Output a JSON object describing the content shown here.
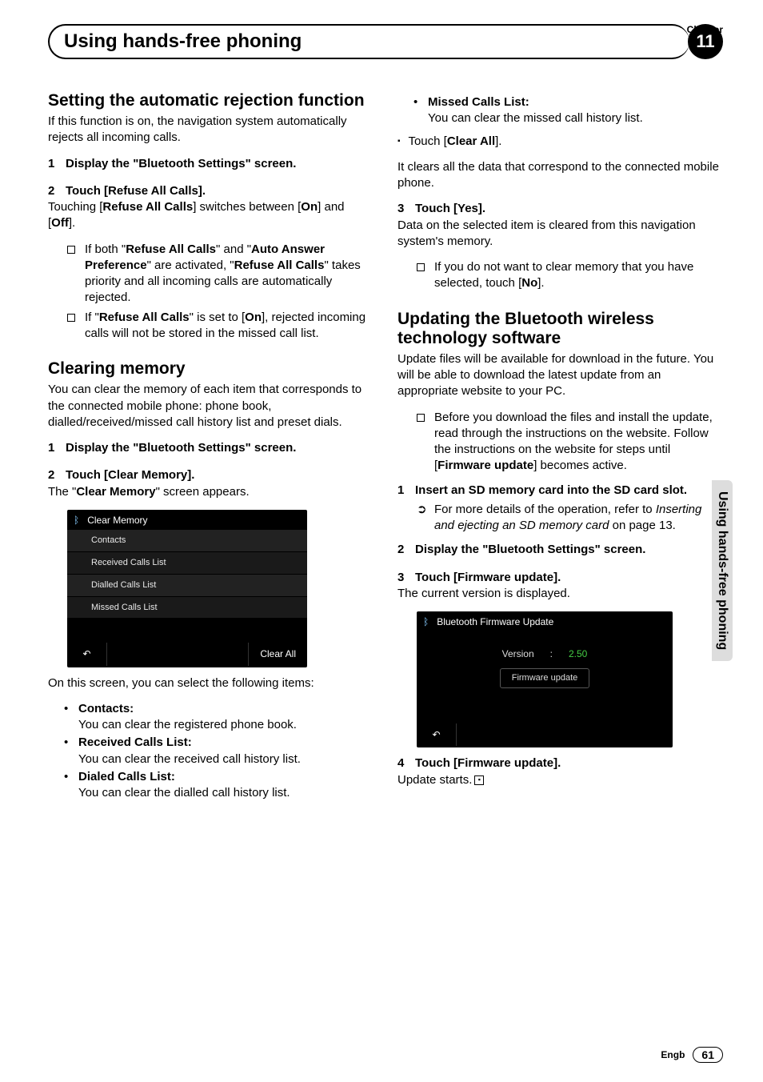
{
  "chapter_label": "Chapter",
  "chapter_number": "11",
  "page_title": "Using hands-free phoning",
  "side_tab": "Using hands-free phoning",
  "footer_lang": "Engb",
  "footer_page": "61",
  "left": {
    "h2a": "Setting the automatic rejection function",
    "p1": "If this function is on, the navigation system automatically rejects all incoming calls.",
    "step1_num": "1",
    "step1": "Display the \"Bluetooth Settings\" screen.",
    "step2_num": "2",
    "step2": "Touch [Refuse All Calls].",
    "p2a": "Touching [",
    "p2b": "Refuse All Calls",
    "p2c": "] switches between [",
    "p2d": "On",
    "p2e": "] and [",
    "p2f": "Off",
    "p2g": "].",
    "note1a": "If both \"",
    "note1b": "Refuse All Calls",
    "note1c": "\" and \"",
    "note1d": "Auto Answer Preference",
    "note1e": "\" are activated, \"",
    "note1f": "Refuse All Calls",
    "note1g": "\" takes priority and all incoming calls are automatically rejected.",
    "note2a": "If \"",
    "note2b": "Refuse All Calls",
    "note2c": "\" is set to [",
    "note2d": "On",
    "note2e": "], rejected incoming calls will not be stored in the missed call list.",
    "h2b": "Clearing memory",
    "p3": "You can clear the memory of each item that corresponds to the connected mobile phone: phone book, dialled/received/missed call history list and preset dials.",
    "step3_num": "1",
    "step3": "Display the \"Bluetooth Settings\" screen.",
    "step4_num": "2",
    "step4": "Touch [Clear Memory].",
    "p4a": "The \"",
    "p4b": "Clear Memory",
    "p4c": "\" screen appears.",
    "ss_title": "Clear Memory",
    "ss_r1": "Contacts",
    "ss_r2": "Received Calls List",
    "ss_r3": "Dialled Calls List",
    "ss_r4": "Missed Calls List",
    "ss_back": "↶",
    "ss_clear": "Clear All",
    "p5": "On this screen, you can select the following items:",
    "b1_t": "Contacts:",
    "b1_d": "You can clear the registered phone book.",
    "b2_t": "Received Calls List:",
    "b2_d": "You can clear the received call history list.",
    "b3_t": "Dialed Calls List:",
    "b3_d": "You can clear the dialled call history list."
  },
  "right": {
    "b4_t": "Missed Calls List:",
    "b4_d": "You can clear the missed call history list.",
    "touch_clear_a": "Touch [",
    "touch_clear_b": "Clear All",
    "touch_clear_c": "].",
    "p6": "It clears all the data that correspond to the connected mobile phone.",
    "step5_num": "3",
    "step5": "Touch [Yes].",
    "p7": "Data on the selected item is cleared from this navigation system's memory.",
    "note3a": "If you do not want to clear memory that you have selected, touch [",
    "note3b": "No",
    "note3c": "].",
    "h2c": "Updating the Bluetooth wireless technology software",
    "p8": "Update files will be available for download in the future. You will be able to download the latest update from an appropriate website to your PC.",
    "note4a": "Before you download the files and install the update, read through the instructions on the website. Follow the instructions on the website for steps until [",
    "note4b": "Firmware update",
    "note4c": "] becomes active.",
    "step6_num": "1",
    "step6": "Insert an SD memory card into the SD card slot.",
    "ref1a": "For more details of the operation, refer to ",
    "ref1b": "Inserting and ejecting an SD memory card",
    "ref1c": " on page 13.",
    "step7_num": "2",
    "step7": "Display the \"Bluetooth Settings\" screen.",
    "step8_num": "3",
    "step8": "Touch [Firmware update].",
    "p9": "The current version is displayed.",
    "ss2_title": "Bluetooth Firmware Update",
    "ss2_ver_l": "Version",
    "ss2_ver_c": ":",
    "ss2_ver_v": "2.50",
    "ss2_btn": "Firmware update",
    "ss2_back": "↶",
    "step9_num": "4",
    "step9": "Touch [Firmware update].",
    "p10": "Update starts."
  }
}
